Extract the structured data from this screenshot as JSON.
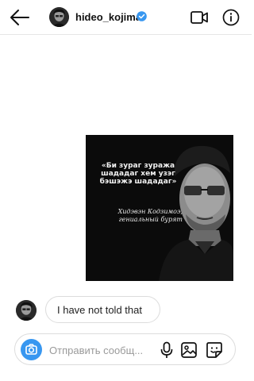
{
  "header": {
    "username": "hideo_kojima",
    "back_icon": "arrow-left-icon",
    "verified_icon": "verified-badge-icon",
    "video_icon": "video-camera-icon",
    "info_icon": "info-circle-icon"
  },
  "shared_post": {
    "quote": "«Би зураг зуража шададаг хем узэг бэшэжэ шададаг»",
    "author": "Хидэвэн Кодзимоэ, гениальный бурят"
  },
  "messages": [
    {
      "text": "I have not told that",
      "sender": "hideo_kojima"
    }
  ],
  "composer": {
    "placeholder": "Отправить сообщ...",
    "camera_icon": "camera-icon",
    "mic_icon": "microphone-icon",
    "gallery_icon": "gallery-icon",
    "sticker_icon": "sticker-icon"
  },
  "colors": {
    "accent": "#3897f0",
    "border": "#dcdcdc",
    "post_background": "#0b0b0b"
  }
}
